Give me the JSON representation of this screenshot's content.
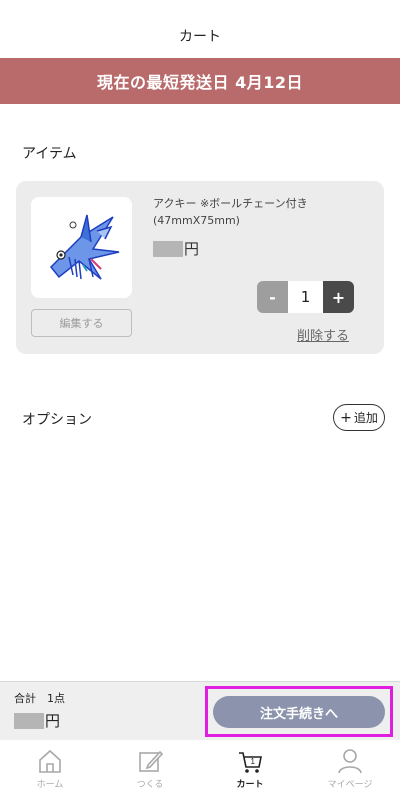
{
  "header": {
    "title": "カート"
  },
  "banner": {
    "text": "現在の最短発送日 4月12日"
  },
  "items_section": {
    "label": "アイテム"
  },
  "item": {
    "name": "アクキー ※ボールチェーン付き (47mmX75mm)",
    "price_suffix": "円",
    "edit_label": "編集する",
    "quantity": "1",
    "minus_label": "-",
    "plus_label": "+",
    "delete_label": "削除する"
  },
  "options_section": {
    "label": "オプション",
    "add_label": "追加"
  },
  "footer": {
    "total_label": "合計　1点",
    "price_suffix": "円",
    "checkout_label": "注文手続きへ"
  },
  "tabs": [
    {
      "label": "ホーム",
      "icon": "home-icon"
    },
    {
      "label": "つくる",
      "icon": "edit-icon"
    },
    {
      "label": "カート",
      "icon": "cart-icon",
      "badge": "1"
    },
    {
      "label": "マイページ",
      "icon": "user-icon"
    }
  ],
  "colors": {
    "banner": "#b96b6b",
    "checkout": "#8b93ad",
    "highlight": "#e01ee0"
  }
}
